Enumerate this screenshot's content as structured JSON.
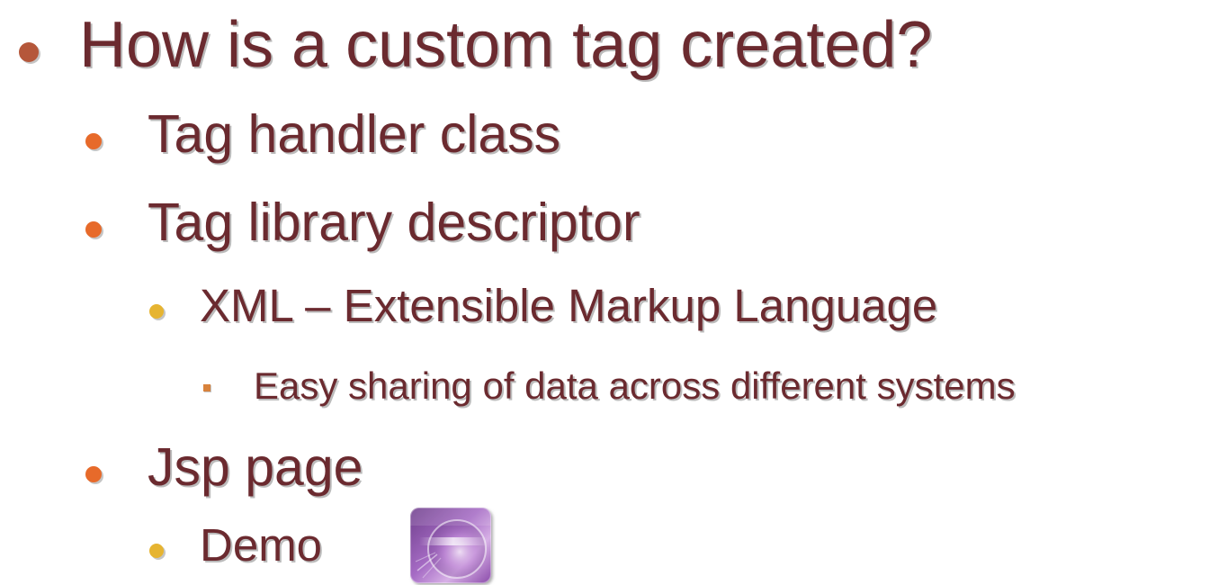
{
  "slide": {
    "items": [
      {
        "level": 1,
        "text": "How is a custom tag created?"
      },
      {
        "level": 2,
        "text": "Tag handler class"
      },
      {
        "level": 2,
        "text": "Tag library descriptor"
      },
      {
        "level": 3,
        "text": "XML – Extensible Markup Language"
      },
      {
        "level": 4,
        "text": "Easy sharing of data across different systems"
      },
      {
        "level": 2,
        "text": "Jsp page"
      },
      {
        "level": 3,
        "text": "Demo"
      }
    ],
    "demo_icon": "media-play-icon"
  },
  "colors": {
    "text": "#6b2a2f",
    "bullet_level1": "#b5573a",
    "bullet_level2": "#e76a2a",
    "bullet_level3": "#e6b431",
    "bullet_level4": "#d8823c"
  }
}
